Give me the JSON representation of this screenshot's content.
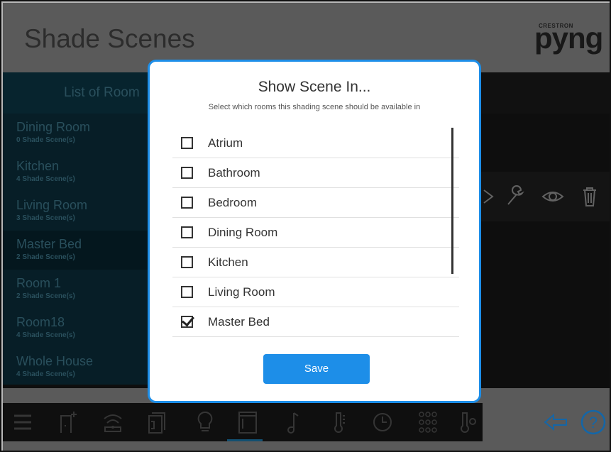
{
  "header": {
    "title": "Shade Scenes",
    "logo_brand": "CRESTRON",
    "logo_mark": "pyng"
  },
  "rooms": {
    "header_label": "List of Room",
    "items": [
      {
        "name": "Dining Room",
        "count": "0 Shade Scene(s)"
      },
      {
        "name": "Kitchen",
        "count": "4 Shade Scene(s)"
      },
      {
        "name": "Living Room",
        "count": "3 Shade Scene(s)"
      },
      {
        "name": "Master Bed",
        "count": "2 Shade Scene(s)"
      },
      {
        "name": "Room 1",
        "count": "2 Shade Scene(s)"
      },
      {
        "name": "Room18",
        "count": "4 Shade Scene(s)"
      },
      {
        "name": "Whole House",
        "count": "4 Shade Scene(s)"
      }
    ],
    "selected_index": 3
  },
  "modal": {
    "title": "Show Scene In...",
    "subtitle": "Select which rooms this shading scene should be available in",
    "items": [
      {
        "label": "Atrium",
        "checked": false
      },
      {
        "label": "Bathroom",
        "checked": false
      },
      {
        "label": "Bedroom",
        "checked": false
      },
      {
        "label": "Dining Room",
        "checked": false
      },
      {
        "label": "Kitchen",
        "checked": false
      },
      {
        "label": "Living Room",
        "checked": false
      },
      {
        "label": "Master Bed",
        "checked": true
      }
    ],
    "save_label": "Save"
  },
  "colors": {
    "accent": "#1d8ee8",
    "header_bg": "#7d7d7d",
    "rooms_bg": "#0a2a36"
  },
  "icons": {
    "scene_row": [
      "play-icon",
      "wrench-icon",
      "eye-icon",
      "trash-icon"
    ],
    "toolbar": [
      "menu-icon",
      "door-add-icon",
      "wifi-icon",
      "shades-icon",
      "bulb-icon",
      "window-icon",
      "music-icon",
      "thermometer-icon",
      "clock-icon",
      "keypad-icon",
      "temperature-sensor-icon"
    ],
    "footer_right": [
      "back-icon",
      "help-icon"
    ]
  }
}
